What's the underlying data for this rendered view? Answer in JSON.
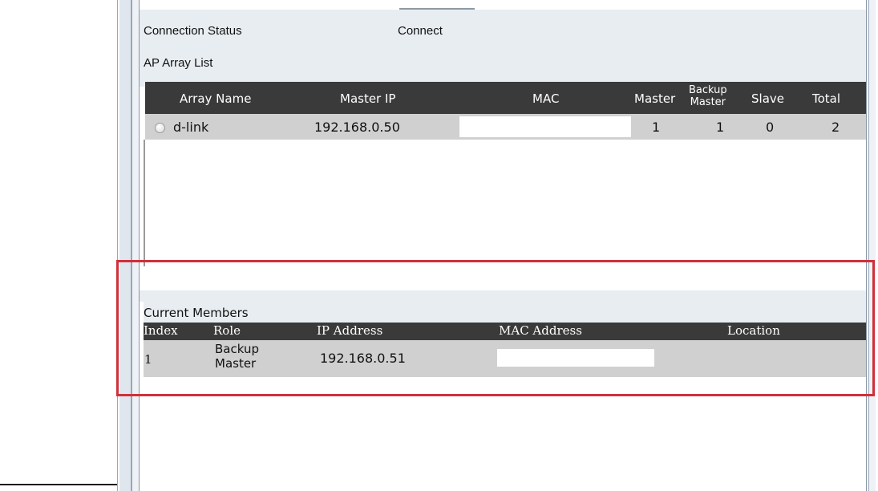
{
  "connection": {
    "label": "Connection Status",
    "value": "Connect"
  },
  "ap_array_list": {
    "title": "AP Array List",
    "columns": {
      "array_name": "Array Name",
      "master_ip": "Master IP",
      "mac": "MAC",
      "master": "Master",
      "backup_master": "Backup Master",
      "backup_line1": "Backup",
      "backup_line2": "Master",
      "slave": "Slave",
      "total": "Total"
    },
    "rows": [
      {
        "array_name": "d-link",
        "master_ip": "192.168.0.50",
        "mac": "",
        "master": "1",
        "backup_master": "1",
        "slave": "0",
        "total": "2",
        "selected": false
      }
    ]
  },
  "current_members": {
    "title": "Current Members",
    "columns": {
      "index": "Index",
      "role": "Role",
      "ip_address": "IP Address",
      "mac_address": "MAC Address",
      "location": "Location"
    },
    "rows": [
      {
        "index": "1",
        "role_line1": "Backup",
        "role_line2": "Master",
        "ip_address": "192.168.0.51",
        "mac_address": "",
        "location": ""
      }
    ]
  },
  "colors": {
    "header_bg": "#3a3a3a",
    "row_bg": "#d0d0d0",
    "panel_bg": "#e8edf1",
    "highlight": "#d0303a"
  }
}
